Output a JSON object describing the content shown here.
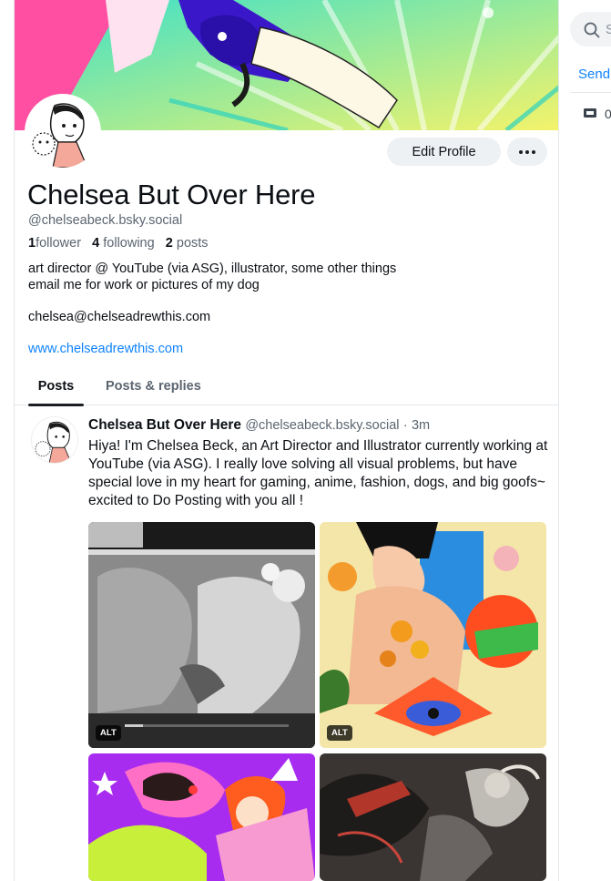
{
  "profile": {
    "display_name": "Chelsea But Over Here",
    "handle": "@chelseabeck.bsky.social",
    "followers_count": "1",
    "followers_label": "follower",
    "following_count": "4",
    "following_label": "following",
    "posts_count": "2",
    "posts_label": "posts",
    "bio_line1": "art director @ YouTube (via ASG), illustrator, some other things",
    "bio_line2": "email me for work or pictures of my dog",
    "email": "chelsea@chelseadrewthis.com",
    "website": "www.chelseadrewthis.com",
    "edit_label": "Edit Profile"
  },
  "tabs": [
    {
      "label": "Posts",
      "active": true
    },
    {
      "label": "Posts & replies",
      "active": false
    }
  ],
  "post": {
    "author": "Chelsea But Over Here",
    "handle": "@chelseabeck.bsky.social",
    "separator": "·",
    "time": "3m",
    "text": "Hiya! I'm Chelsea Beck, an Art Director and Illustrator currently working at YouTube (via ASG). I really love solving all visual problems, but have special love in my heart for gaming, anime, fashion, dogs, and big goofs~ excited to Do Posting with you all !",
    "images": [
      {
        "alt_badge": "ALT"
      },
      {
        "alt_badge": "ALT"
      },
      {
        "alt_badge": ""
      },
      {
        "alt_badge": ""
      }
    ]
  },
  "right_panel": {
    "search_placeholder": "S",
    "send_link": "Send",
    "ticket_count": "0"
  },
  "colors": {
    "accent": "#1083fe",
    "muted_text": "#5b6570",
    "button_bg": "#eef1f4"
  }
}
